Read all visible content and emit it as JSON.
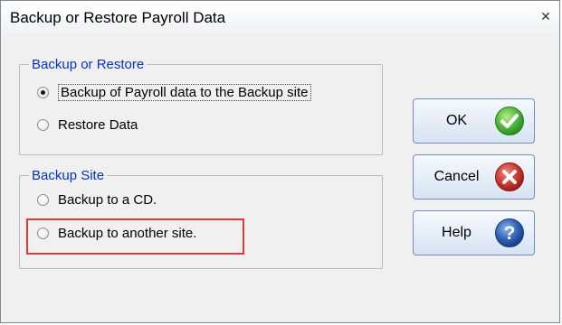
{
  "window": {
    "title": "Backup or Restore Payroll Data",
    "close_glyph": "✕"
  },
  "group_backup_restore": {
    "legend": "Backup or Restore",
    "options": [
      {
        "label": "Backup of Payroll data to the Backup site",
        "checked": true
      },
      {
        "label": "Restore Data",
        "checked": false
      }
    ]
  },
  "group_backup_site": {
    "legend": "Backup Site",
    "options": [
      {
        "label": "Backup to a CD.",
        "checked": false
      },
      {
        "label": "Backup to another site.",
        "checked": false
      }
    ]
  },
  "buttons": {
    "ok": {
      "label": "OK",
      "icon": "check-icon",
      "color": "#3da92f"
    },
    "cancel": {
      "label": "Cancel",
      "icon": "x-circle-icon",
      "color": "#c62828"
    },
    "help": {
      "label": "Help",
      "icon": "question-icon",
      "color": "#1f4e9c"
    }
  },
  "highlight_color": "#e53935"
}
